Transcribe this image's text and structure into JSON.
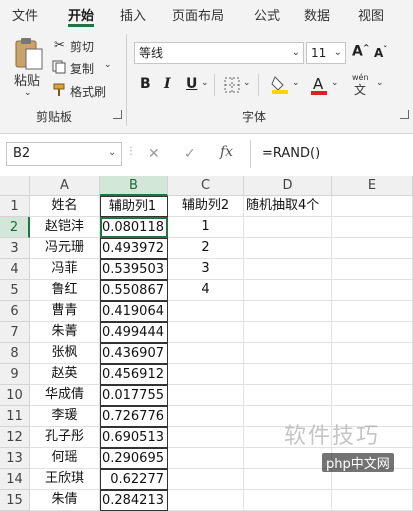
{
  "ribbon": {
    "tabs": [
      "文件",
      "开始",
      "插入",
      "页面布局",
      "公式",
      "数据",
      "视图"
    ],
    "active_tab": "开始",
    "clipboard": {
      "paste_label": "粘贴",
      "cut_label": "剪切",
      "copy_label": "复制",
      "format_painter_label": "格式刷",
      "group_label": "剪贴板"
    },
    "font": {
      "font_name": "等线",
      "font_size": "11",
      "bold": "B",
      "italic": "I",
      "underline": "U",
      "grow": "A",
      "shrink": "A",
      "font_color_letter": "A",
      "phonetic": "wén",
      "group_label": "字体"
    },
    "colors": {
      "accent": "#217346",
      "highlight": "#ffd200",
      "font_color": "#e02020"
    }
  },
  "formula_bar": {
    "name_box": "B2",
    "cancel_icon": "✕",
    "enter_icon": "✓",
    "fx_label": "fx",
    "formula": "=RAND()"
  },
  "sheet": {
    "columns": [
      "A",
      "B",
      "C",
      "D",
      "E"
    ],
    "rows": [
      {
        "num": "1",
        "a": "姓名",
        "b": "辅助列1",
        "c": "辅助列2",
        "d": "随机抽取4个"
      },
      {
        "num": "2",
        "a": "赵铠沣",
        "b": "0.080118",
        "c": "1",
        "d": ""
      },
      {
        "num": "3",
        "a": "冯元珊",
        "b": "0.493972",
        "c": "2",
        "d": ""
      },
      {
        "num": "4",
        "a": "冯菲",
        "b": "0.539503",
        "c": "3",
        "d": ""
      },
      {
        "num": "5",
        "a": "鲁红",
        "b": "0.550867",
        "c": "4",
        "d": ""
      },
      {
        "num": "6",
        "a": "曹青",
        "b": "0.419064",
        "c": "",
        "d": ""
      },
      {
        "num": "7",
        "a": "朱菁",
        "b": "0.499444",
        "c": "",
        "d": ""
      },
      {
        "num": "8",
        "a": "张枫",
        "b": "0.436907",
        "c": "",
        "d": ""
      },
      {
        "num": "9",
        "a": "赵英",
        "b": "0.456912",
        "c": "",
        "d": ""
      },
      {
        "num": "10",
        "a": "华成倩",
        "b": "0.017755",
        "c": "",
        "d": ""
      },
      {
        "num": "11",
        "a": "李瑗",
        "b": "0.726776",
        "c": "",
        "d": ""
      },
      {
        "num": "12",
        "a": "孔子彤",
        "b": "0.690513",
        "c": "",
        "d": ""
      },
      {
        "num": "13",
        "a": "何瑶",
        "b": "0.290695",
        "c": "",
        "d": ""
      },
      {
        "num": "14",
        "a": "王欣琪",
        "b": "0.62277",
        "c": "",
        "d": ""
      },
      {
        "num": "15",
        "a": "朱倩",
        "b": "0.284213",
        "c": "",
        "d": ""
      }
    ],
    "selected_cell": "B2"
  },
  "watermark": {
    "text": "软件技巧",
    "logo": "php中文网"
  }
}
